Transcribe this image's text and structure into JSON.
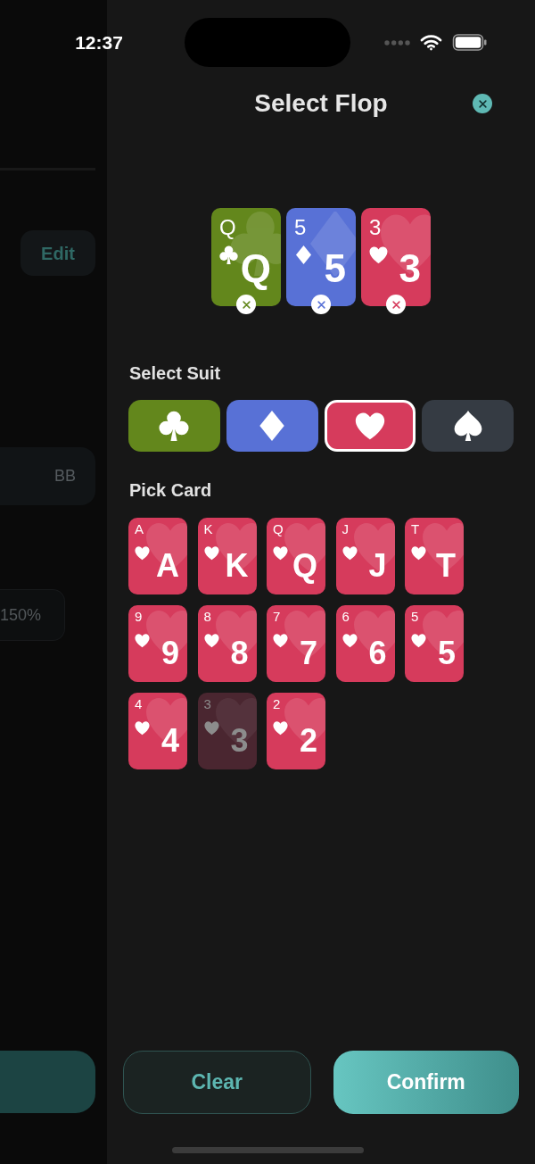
{
  "status_bar": {
    "time": "12:37"
  },
  "background_page": {
    "edit_button": "Edit",
    "unit_field": {
      "unit": "BB"
    },
    "percent_field": {
      "value": "150%"
    }
  },
  "sheet": {
    "title": "Select Flop"
  },
  "flop": [
    {
      "rank": "Q",
      "rank_large": "Q",
      "kind": "clubs"
    },
    {
      "rank": "5",
      "rank_large": "5",
      "kind": "diamonds"
    },
    {
      "rank": "3",
      "rank_large": "3",
      "kind": "hearts"
    }
  ],
  "select_suit": {
    "label": "Select Suit",
    "options": [
      {
        "kind": "clubs",
        "selected": false
      },
      {
        "kind": "diamonds",
        "selected": false
      },
      {
        "kind": "hearts",
        "selected": true
      },
      {
        "kind": "spades",
        "selected": false
      }
    ]
  },
  "pick_card": {
    "label": "Pick Card",
    "cards": [
      {
        "rank": "A",
        "rank_large": "A",
        "disabled": false
      },
      {
        "rank": "K",
        "rank_large": "K",
        "disabled": false
      },
      {
        "rank": "Q",
        "rank_large": "Q",
        "disabled": false
      },
      {
        "rank": "J",
        "rank_large": "J",
        "disabled": false
      },
      {
        "rank": "T",
        "rank_large": "T",
        "disabled": false
      },
      {
        "rank": "9",
        "rank_large": "9",
        "disabled": false
      },
      {
        "rank": "8",
        "rank_large": "8",
        "disabled": false
      },
      {
        "rank": "7",
        "rank_large": "7",
        "disabled": false
      },
      {
        "rank": "6",
        "rank_large": "6",
        "disabled": false
      },
      {
        "rank": "5",
        "rank_large": "5",
        "disabled": false
      },
      {
        "rank": "4",
        "rank_large": "4",
        "disabled": false
      },
      {
        "rank": "3",
        "rank_large": "3",
        "disabled": true
      },
      {
        "rank": "2",
        "rank_large": "2",
        "disabled": false
      }
    ]
  },
  "buttons": [
    {
      "label": "Clear",
      "kind": "secondary"
    },
    {
      "label": "Confirm",
      "kind": "primary"
    }
  ]
}
